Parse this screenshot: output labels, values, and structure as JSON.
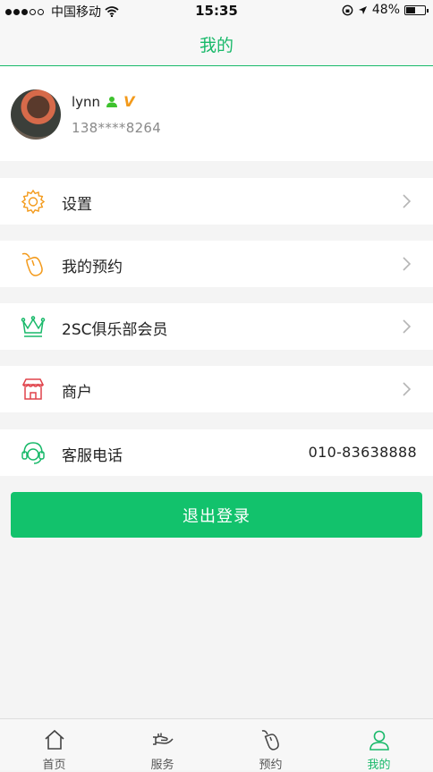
{
  "status_bar": {
    "carrier": "中国移动",
    "time": "15:35",
    "battery": "48%",
    "battery_level": 0.48
  },
  "header": {
    "title": "我的"
  },
  "profile": {
    "name": "lynn",
    "phone": "138****8264",
    "badge_v": "V"
  },
  "menu": {
    "settings": {
      "label": "设置",
      "icon": "gear-icon"
    },
    "appointments": {
      "label": "我的预约",
      "icon": "mouse-icon"
    },
    "club": {
      "label": "2SC俱乐部会员",
      "icon": "crown-icon"
    },
    "merchant": {
      "label": "商户",
      "icon": "storefront-icon"
    },
    "service": {
      "label": "客服电话",
      "icon": "headset-icon",
      "value": "010-83638888"
    }
  },
  "logout_label": "退出登录",
  "tabs": [
    {
      "label": "首页",
      "icon": "home-icon"
    },
    {
      "label": "服务",
      "icon": "hand-icon"
    },
    {
      "label": "预约",
      "icon": "mouse-icon"
    },
    {
      "label": "我的",
      "icon": "user-icon",
      "active": true
    }
  ],
  "colors": {
    "accent": "#19b96a",
    "button": "#12c26c",
    "orange": "#f39a1b",
    "merchant_red": "#e0434b"
  }
}
